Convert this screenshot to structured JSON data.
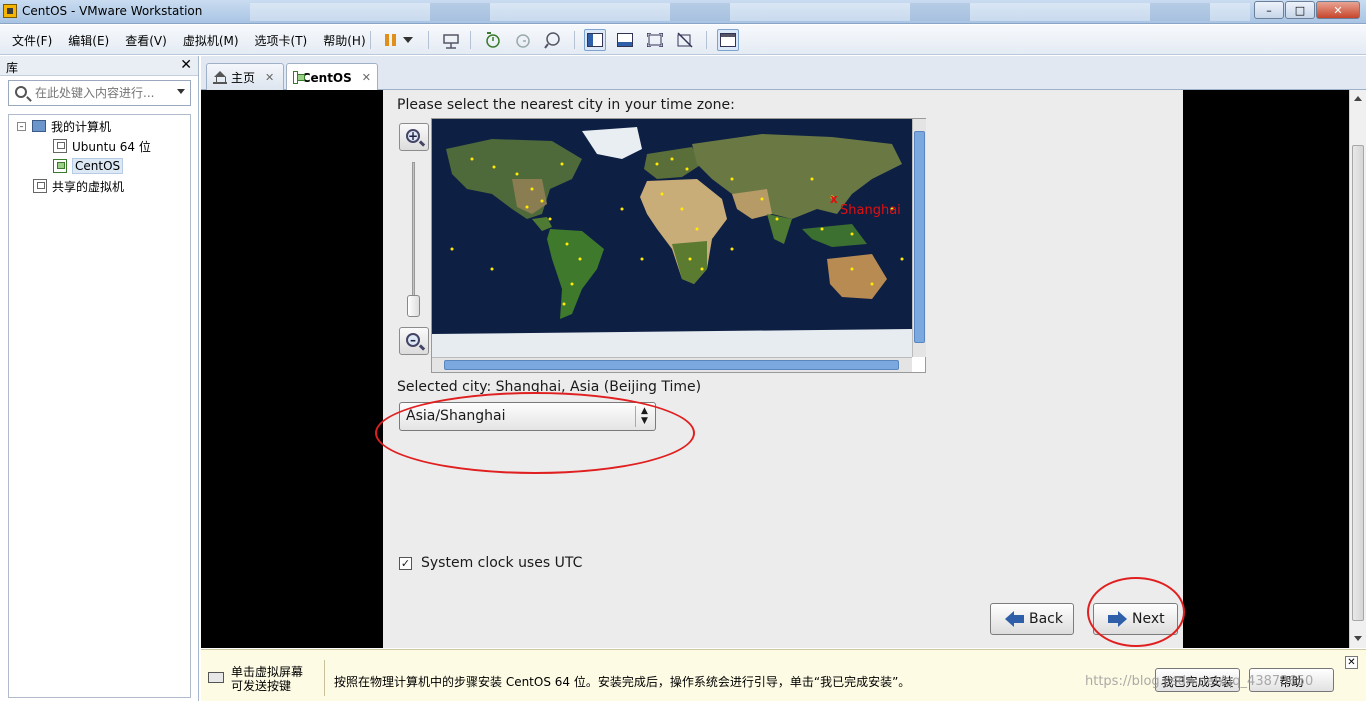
{
  "window": {
    "title": "CentOS - VMware Workstation"
  },
  "menu": [
    "文件(F)",
    "编辑(E)",
    "查看(V)",
    "虚拟机(M)",
    "选项卡(T)",
    "帮助(H)"
  ],
  "library": {
    "title": "库",
    "search_placeholder": "在此处键入内容进行...",
    "tree": {
      "my_computer": "我的计算机",
      "vm1": "Ubuntu 64 位",
      "vm2": "CentOS",
      "shared": "共享的虚拟机"
    }
  },
  "tabs": [
    {
      "label": "主页"
    },
    {
      "label": "CentOS"
    }
  ],
  "installer": {
    "prompt": "Please select the nearest city in your time zone:",
    "map_city": "Shanghai",
    "selected_city": "Selected city: Shanghai, Asia (Beijing Time)",
    "timezone_value": "Asia/Shanghai",
    "utc_label": "System clock uses UTC",
    "utc_checked": true,
    "back_label": "Back",
    "next_label": "Next"
  },
  "bottom_bar": {
    "hint": "单击虚拟屏幕\n可发送按键",
    "message": "按照在物理计算机中的步骤安装 CentOS 64 位。安装完成后，操作系统会进行引导，单击“我已完成安装”。",
    "done_button": "我已完成安装",
    "help_button": "帮助"
  },
  "watermark": "https://blog.csdn.net/qq_43873650",
  "colors": {
    "annotation": "#e02020",
    "city_marker": "#e01010",
    "map_ocean": "#0e1f44",
    "accent": "#2e5fa8"
  }
}
